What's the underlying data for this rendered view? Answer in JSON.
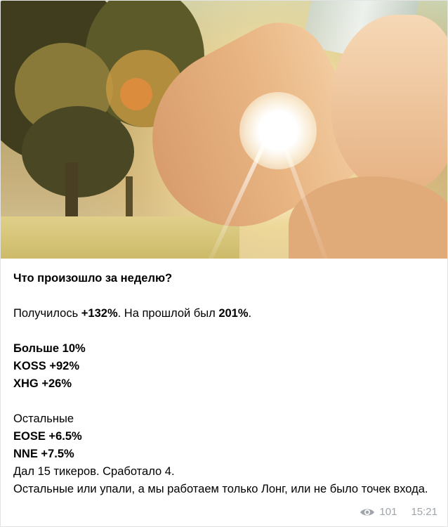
{
  "post": {
    "title": "Что произошло за неделю?",
    "summary": {
      "prefix": "Получилось ",
      "gain": "+132%",
      "middle": ". На прошлой был ",
      "previous": "201%",
      "suffix": "."
    },
    "big_section": {
      "heading": "Больше 10%",
      "items": [
        "KOSS +92%",
        "XHG +26%"
      ]
    },
    "rest_section": {
      "heading": "Остальные",
      "items": [
        "EOSE +6.5%",
        "NNE +7.5%"
      ]
    },
    "line_tickers": "Дал 15 тикеров. Сработало 4.",
    "line_rest": "Остальные или упали, а мы работаем  только Лонг, или не было точек входа."
  },
  "meta": {
    "views": "101",
    "time": "15:21",
    "views_icon": "eye-icon"
  }
}
